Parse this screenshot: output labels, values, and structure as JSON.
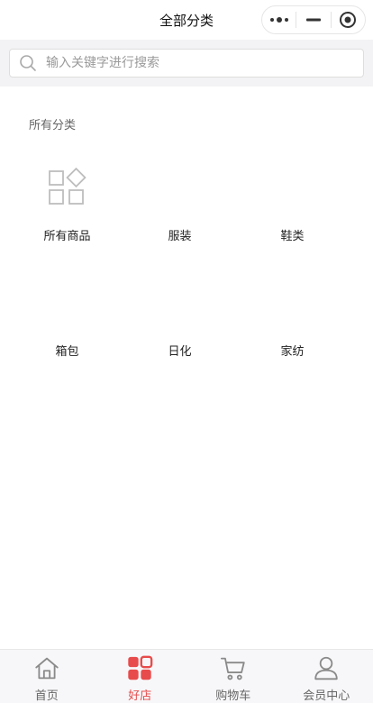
{
  "navbar": {
    "title": "全部分类"
  },
  "search": {
    "placeholder": "输入关键字进行搜索"
  },
  "section": {
    "title": "所有分类"
  },
  "categories": [
    {
      "label": "所有商品",
      "icon": "all-products-grid-icon"
    },
    {
      "label": "服装"
    },
    {
      "label": "鞋类"
    },
    {
      "label": "箱包"
    },
    {
      "label": "日化"
    },
    {
      "label": "家纺"
    }
  ],
  "tabbar": {
    "active_color": "#e84b4b",
    "inactive_color": "#666666",
    "items": [
      {
        "label": "首页",
        "icon": "home-icon",
        "active": false
      },
      {
        "label": "好店",
        "icon": "store-grid-icon",
        "active": true
      },
      {
        "label": "购物车",
        "icon": "cart-icon",
        "active": false
      },
      {
        "label": "会员中心",
        "icon": "user-icon",
        "active": false
      }
    ]
  }
}
